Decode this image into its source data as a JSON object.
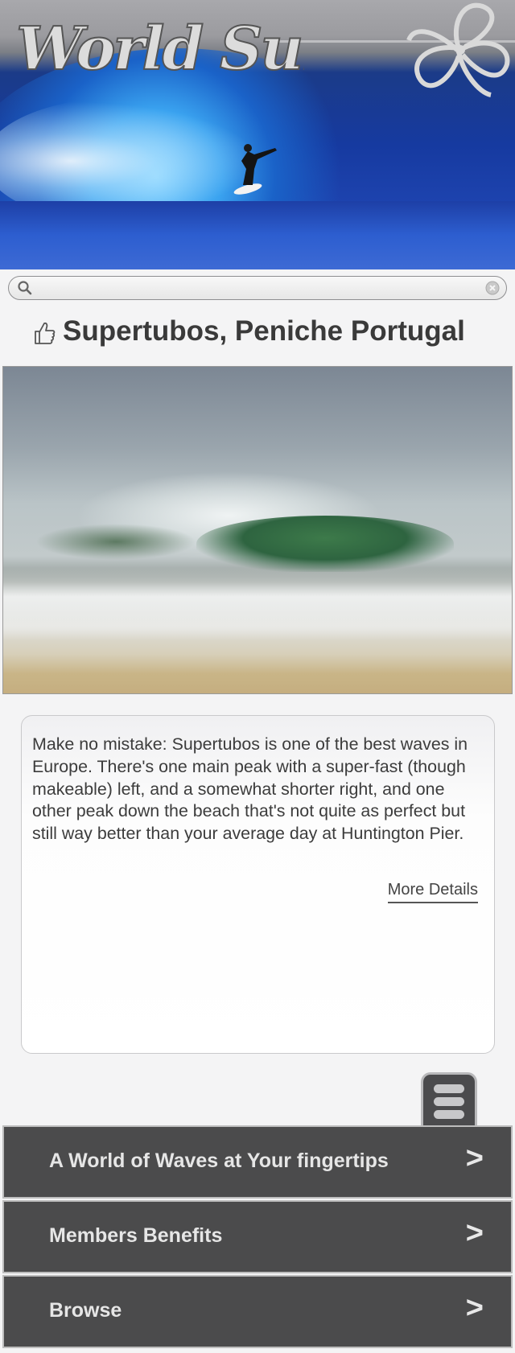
{
  "header": {
    "logo_text": "World Surf",
    "logo_icon": "hibiscus-flower-icon"
  },
  "search": {
    "placeholder": "",
    "value": "",
    "search_icon": "search-icon",
    "clear_icon": "clear-icon"
  },
  "spot": {
    "title": "Supertubos, Peniche Portugal",
    "like_icon": "thumbs-up-icon",
    "description": "Make no mistake: Supertubos is one of the best waves in Europe. There's one main peak with a super-fast (though makeable) left, and a somewhat shorter right, and one other peak down the beach that's not quite as perfect but still way better than your average day at Huntington Pier.",
    "more_details_label": "More Details"
  },
  "menu": {
    "icon": "hamburger-menu-icon",
    "items": [
      {
        "label": "A World of Waves at Your fingertips",
        "arrow": ">"
      },
      {
        "label": "Members Benefits",
        "arrow": ">"
      },
      {
        "label": "Browse",
        "arrow": ">"
      }
    ]
  },
  "colors": {
    "nav_background": "#4b4b4c",
    "title_text": "#3a3a3a",
    "page_background": "#f4f4f5"
  }
}
